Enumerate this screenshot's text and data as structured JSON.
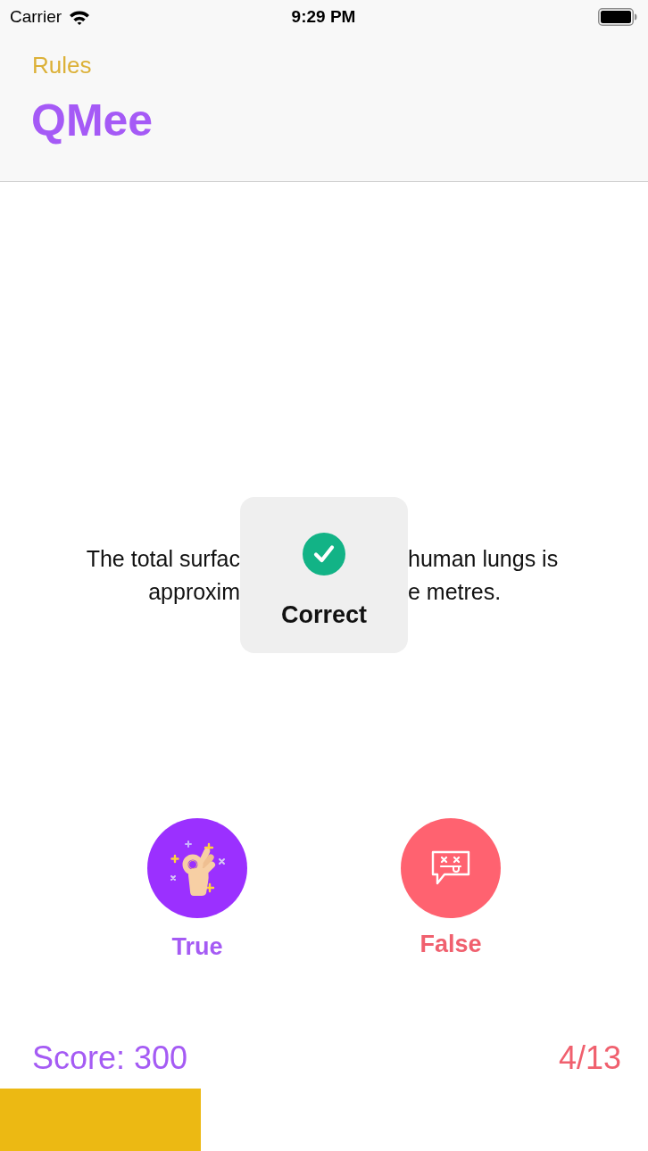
{
  "status_bar": {
    "carrier": "Carrier",
    "time": "9:29 PM"
  },
  "nav": {
    "back_label": "Rules",
    "title": "QMee"
  },
  "question": {
    "lines": [
      {
        "before_hud": "The total surfac",
        "after_hud": "human lungs is"
      },
      {
        "before_hud": "approxim",
        "after_hud": "e metres."
      }
    ]
  },
  "hud": {
    "kind": "success",
    "message": "Correct"
  },
  "answers": [
    {
      "kind": "true",
      "label": "True",
      "color": "#9b30ff"
    },
    {
      "kind": "false",
      "label": "False",
      "color": "#ff6270"
    }
  ],
  "footer": {
    "score": "Score: 300",
    "progress_text": "4/13"
  },
  "progress": {
    "level": 0.31
  }
}
